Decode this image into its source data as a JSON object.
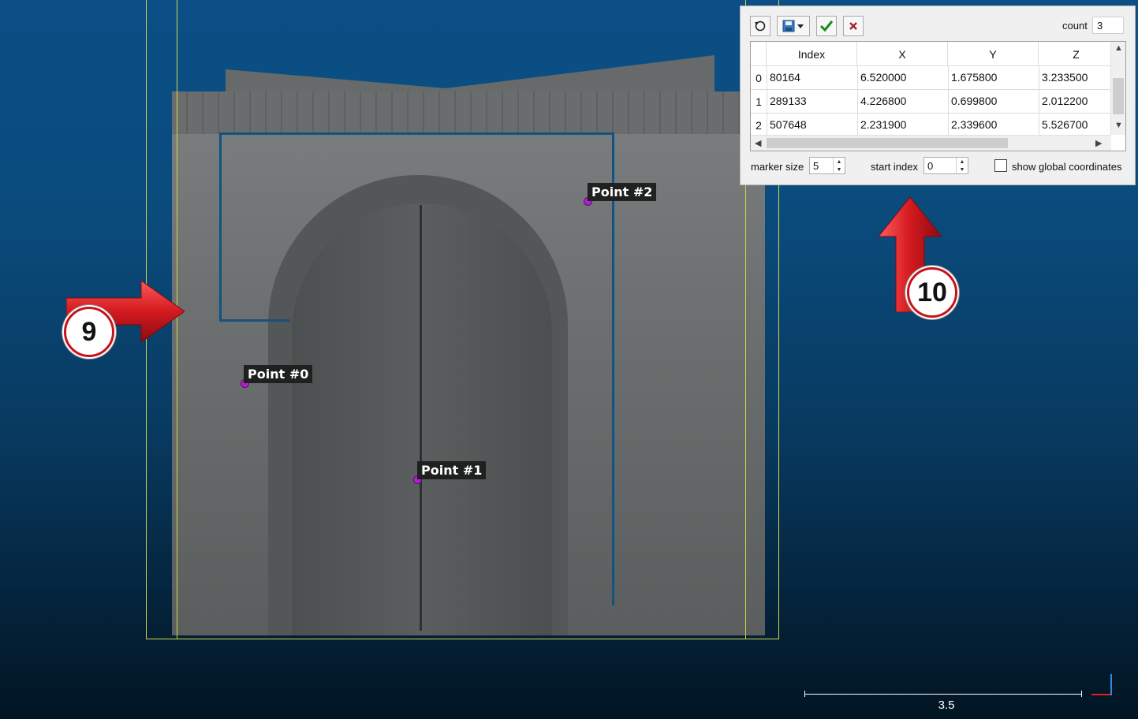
{
  "points": [
    {
      "label": "Point #0"
    },
    {
      "label": "Point #1"
    },
    {
      "label": "Point #2"
    }
  ],
  "annotations": {
    "badge_left": "9",
    "badge_right": "10",
    "arrow_color": "#d31a1f"
  },
  "scale": {
    "value": "3.5"
  },
  "dialog": {
    "count_label": "count",
    "count_value": "3",
    "columns": {
      "row": "",
      "index": "Index",
      "x": "X",
      "y": "Y",
      "z": "Z"
    },
    "rows": [
      {
        "n": "0",
        "index": "80164",
        "x": "6.520000",
        "y": "1.675800",
        "z": "3.233500"
      },
      {
        "n": "1",
        "index": "289133",
        "x": "4.226800",
        "y": "0.699800",
        "z": "2.012200"
      },
      {
        "n": "2",
        "index": "507648",
        "x": "2.231900",
        "y": "2.339600",
        "z": "5.526700"
      }
    ],
    "marker_size_label": "marker size",
    "marker_size_value": "5",
    "start_index_label": "start index",
    "start_index_value": "0",
    "global_coords_label": "show global coordinates",
    "global_coords_checked": false
  }
}
